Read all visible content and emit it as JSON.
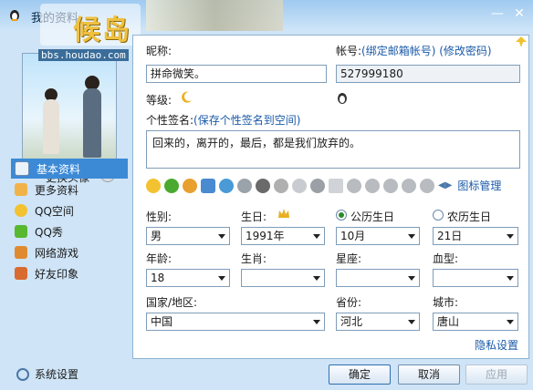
{
  "window": {
    "title": "我的资料",
    "watermark_text": "候岛",
    "watermark_url": "bbs.houdao.com"
  },
  "left": {
    "change_avatar": "更换头像",
    "nav": [
      {
        "label": "基本资料",
        "icon": "id-card-icon",
        "active": true
      },
      {
        "label": "更多资料",
        "icon": "profile-more-icon",
        "active": false
      },
      {
        "label": "QQ空间",
        "icon": "qzone-star-icon",
        "active": false
      },
      {
        "label": "QQ秀",
        "icon": "qqshow-icon",
        "active": false
      },
      {
        "label": "网络游戏",
        "icon": "game-icon",
        "active": false
      },
      {
        "label": "好友印象",
        "icon": "friends-impression-icon",
        "active": false
      }
    ],
    "settings": "系统设置"
  },
  "form": {
    "nickname_label": "昵称:",
    "nickname": "拼命微笑。",
    "account_label": "帐号:",
    "bind_email": "(绑定邮箱帐号)",
    "change_password": "(修改密码)",
    "account": "527999180",
    "level_label": "等级:",
    "signature_label": "个性签名:",
    "save_signature": "(保存个性签名到空间)",
    "signature": "回来的，离开的，最后，都是我们放弃的。",
    "icon_manage": "图标管理",
    "gender_label": "性别:",
    "gender": "男",
    "birthday_label": "生日:",
    "birth_year": "1991年",
    "solar_label": "公历生日",
    "birth_month": "10月",
    "lunar_label": "农历生日",
    "birth_day": "21日",
    "age_label": "年龄:",
    "age": "18",
    "zodiac_label": "生肖:",
    "zodiac": "",
    "constellation_label": "星座:",
    "constellation": "",
    "blood_label": "血型:",
    "blood": "",
    "country_label": "国家/地区:",
    "country": "中国",
    "province_label": "省份:",
    "province": "河北",
    "city_label": "城市:",
    "city": "唐山",
    "privacy": "隐私设置"
  },
  "buttons": {
    "ok": "确定",
    "cancel": "取消",
    "apply": "应用"
  },
  "colors": {
    "accent": "#3c8ad6",
    "link": "#1a5aa8"
  }
}
